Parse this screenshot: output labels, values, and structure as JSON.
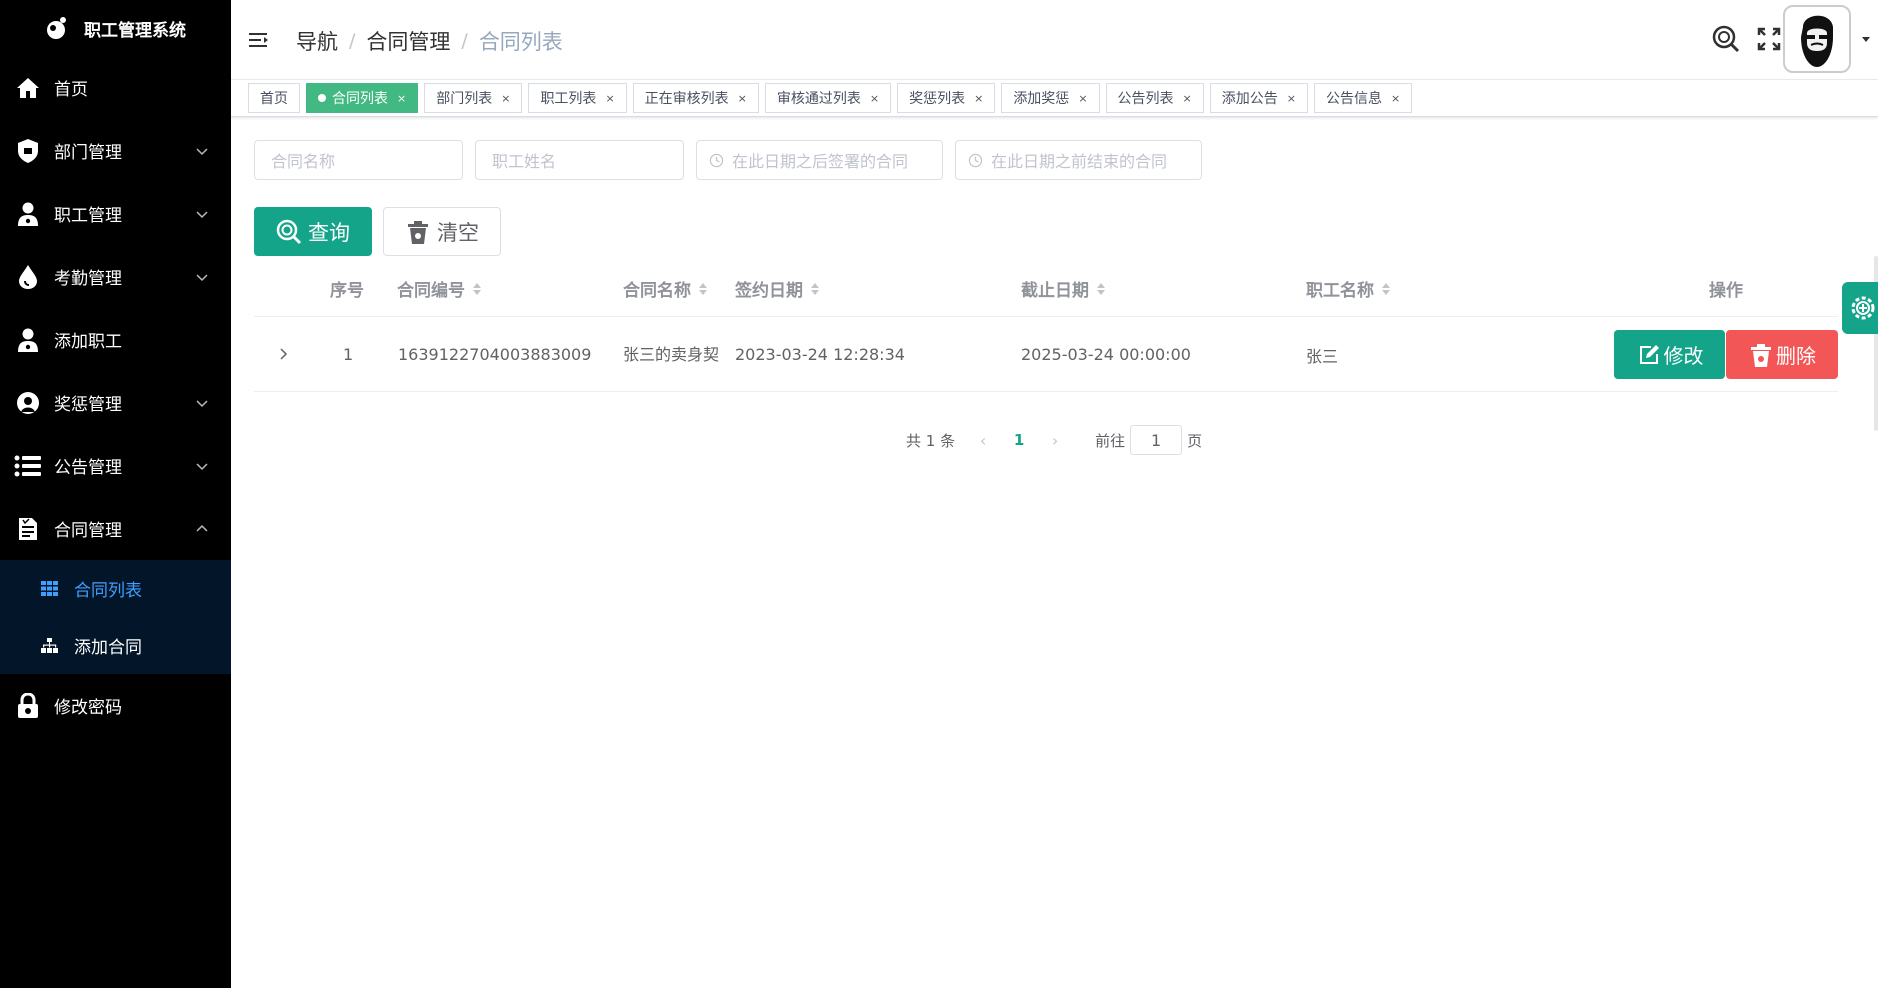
{
  "app": {
    "title": "职工管理系统"
  },
  "sidebar": {
    "items": [
      {
        "label": "首页"
      },
      {
        "label": "部门管理"
      },
      {
        "label": "职工管理"
      },
      {
        "label": "考勤管理"
      },
      {
        "label": "添加职工"
      },
      {
        "label": "奖惩管理"
      },
      {
        "label": "公告管理"
      },
      {
        "label": "合同管理"
      },
      {
        "label": "修改密码"
      }
    ],
    "submenu": [
      {
        "label": "合同列表",
        "active": true
      },
      {
        "label": "添加合同",
        "active": false
      }
    ]
  },
  "breadcrumb": [
    "导航",
    "合同管理",
    "合同列表"
  ],
  "tags": [
    {
      "label": "首页",
      "active": false,
      "closable": false
    },
    {
      "label": "合同列表",
      "active": true,
      "closable": true
    },
    {
      "label": "部门列表",
      "active": false,
      "closable": true
    },
    {
      "label": "职工列表",
      "active": false,
      "closable": true
    },
    {
      "label": "正在审核列表",
      "active": false,
      "closable": true
    },
    {
      "label": "审核通过列表",
      "active": false,
      "closable": true
    },
    {
      "label": "奖惩列表",
      "active": false,
      "closable": true
    },
    {
      "label": "添加奖惩",
      "active": false,
      "closable": true
    },
    {
      "label": "公告列表",
      "active": false,
      "closable": true
    },
    {
      "label": "添加公告",
      "active": false,
      "closable": true
    },
    {
      "label": "公告信息",
      "active": false,
      "closable": true
    }
  ],
  "filters": {
    "contract_name": "合同名称",
    "employee_name": "职工姓名",
    "signed_after": "在此日期之后签署的合同",
    "ended_before": "在此日期之前结束的合同"
  },
  "buttons": {
    "query": "查询",
    "clear": "清空",
    "edit": "修改",
    "delete": "删除"
  },
  "table": {
    "headers": {
      "index": "序号",
      "number": "合同编号",
      "name": "合同名称",
      "sign_date": "签约日期",
      "end_date": "截止日期",
      "employee": "职工名称",
      "actions": "操作"
    },
    "rows": [
      {
        "index": "1",
        "number": "1639122704003883009",
        "name": "张三的卖身契",
        "sign_date": "2023-03-24 12:28:34",
        "end_date": "2025-03-24 00:00:00",
        "employee": "张三"
      }
    ]
  },
  "pagination": {
    "total": "共 1 条",
    "current": "1",
    "goto": "前往",
    "goto_value": "1",
    "page_suffix": "页"
  },
  "colors": {
    "sidebar_bg": "#000000",
    "submenu_bg": "#021529",
    "primary": "#13a48a",
    "danger": "#f25656",
    "active_tag": "#42b983",
    "active_link": "#409eff"
  }
}
